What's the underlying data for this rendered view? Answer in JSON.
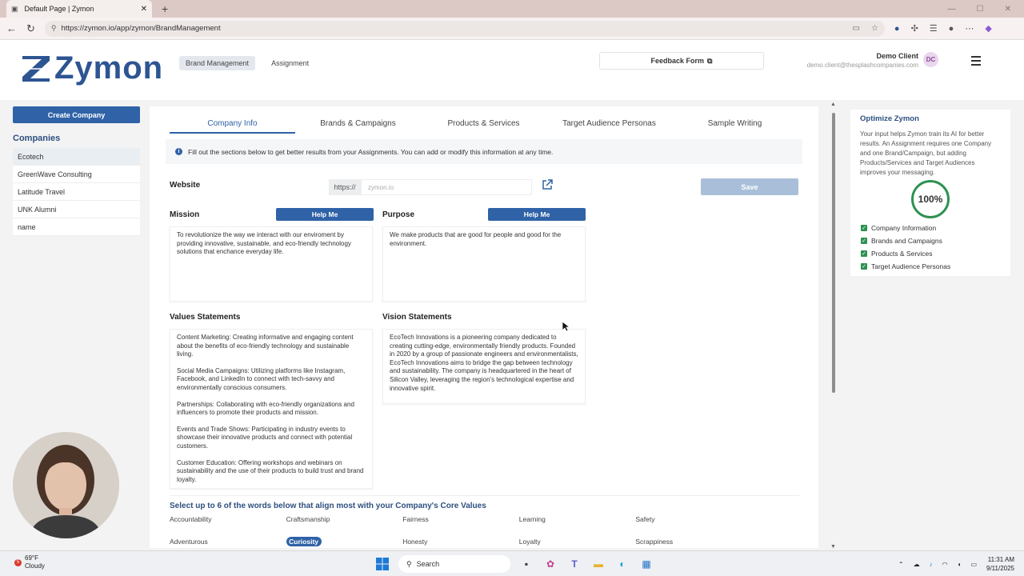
{
  "browser": {
    "tab_title": "Default Page | Zymon",
    "url": "https://zymon.io/app/zymon/BrandManagement"
  },
  "header": {
    "logo_text": "Zymon",
    "nav": [
      "Brand Management",
      "Assignment"
    ],
    "feedback_label": "Feedback Form",
    "user_name": "Demo Client",
    "user_email": "demo.client@thesplashcompanies.com",
    "user_initials": "DC",
    "brand_color": "#2d5592"
  },
  "sidebar": {
    "create_label": "Create Company",
    "companies_heading": "Companies",
    "companies": [
      "Ecotech",
      "GreenWave Consulting",
      "Latitude Travel",
      "UNK Alumni",
      "name"
    ]
  },
  "main": {
    "tabs": [
      "Company Info",
      "Brands & Campaigns",
      "Products & Services",
      "Target Audience Personas",
      "Sample Writing"
    ],
    "info_text": "Fill out the sections below to get better results from your Assignments. You can add or modify this information at any time.",
    "website_label": "Website",
    "website_prefix": "https://",
    "website_placeholder": "zymon.io",
    "save_label": "Save",
    "mission_label": "Mission",
    "purpose_label": "Purpose",
    "help_label": "Help Me",
    "mission_text": "To revolutionize the way we interact with our enviroment by providing innovative, sustainable, and eco-friendly technology solutions that enchance everyday life.",
    "purpose_text": "We make products that are good for people and good for the environment.",
    "values_label": "Values Statements",
    "vision_label": "Vision Statements",
    "values_paragraphs": [
      "Content Marketing: Creating informative and engaging content about the benefits of eco-friendly technology and sustainable living.",
      "Social Media Campaigns: Utilizing platforms like Instagram, Facebook, and LinkedIn to connect with tech-savvy and environmentally conscious consumers.",
      "Partnerships: Collaborating with eco-friendly organizations and influencers to promote their products and mission.",
      "Events and Trade Shows: Participating in industry events to showcase their innovative products and connect with potential customers.",
      "Customer Education: Offering workshops and webinars on sustainability and the use of their products to build trust and brand loyalty."
    ],
    "vision_text": "EcoTech Innovations is a pioneering company dedicated to creating cutting-edge, environmentally friendly products. Founded in 2020 by a group of passionate engineers and environmentalists, EcoTech Innovations aims to bridge the gap between technology and sustainability. The company is headquartered in the heart of Silicon Valley, leveraging the region's technological expertise and innovative spirit.",
    "core_values_heading": "Select up to 6 of the words below that align most with your Company's Core Values",
    "core_words": [
      "Accountability",
      "Craftsmanship",
      "Fairness",
      "Learning",
      "Safety",
      "Adventurous",
      "Curiosity",
      "Honesty",
      "Loyalty",
      "Scrappiness"
    ],
    "selected_words": [
      "Curiosity"
    ],
    "accent_color": "#2f62a7"
  },
  "optimize": {
    "title": "Optimize Zymon",
    "description": "Your input helps Zymon train its AI for better results. An Assignment requires one Company and one Brand/Campaign, but adding Products/Services and Target Audiences improves your messaging.",
    "progress_label": "100%",
    "progress_fraction": 1.0,
    "checklist": [
      "Company Information",
      "Brands and Campaigns",
      "Products & Services",
      "Target Audience Personas"
    ],
    "check_color": "#2e9152"
  },
  "taskbar": {
    "temperature": "69°F",
    "condition": "Cloudy",
    "weather_badge": "5",
    "search_label": "Search",
    "time": "11:31 AM",
    "date": "9/11/2025"
  }
}
